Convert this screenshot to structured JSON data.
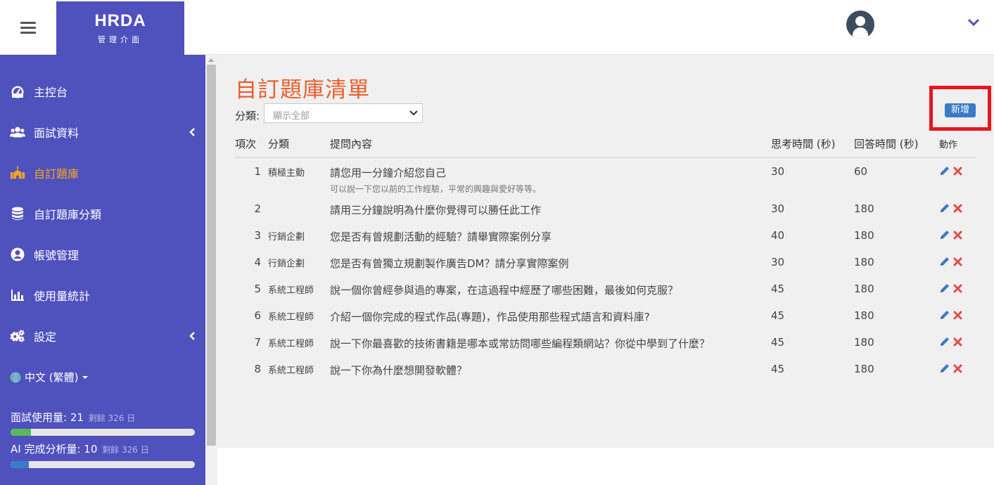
{
  "brand": {
    "name": "HRDA",
    "subtitle": "管理介面"
  },
  "sidebar": {
    "items": [
      {
        "label": "主控台",
        "icon": "dashboard-gauge-icon"
      },
      {
        "label": "面試資料",
        "icon": "users-icon",
        "expandable": true
      },
      {
        "label": "自訂題庫",
        "icon": "custom-bank-icon",
        "active": true
      },
      {
        "label": "自訂題庫分類",
        "icon": "database-icon"
      },
      {
        "label": "帳號管理",
        "icon": "user-circle-icon"
      },
      {
        "label": "使用量統計",
        "icon": "bar-chart-icon"
      },
      {
        "label": "設定",
        "icon": "gears-icon",
        "expandable": true
      }
    ],
    "language": "中文 (繁體)",
    "usage": [
      {
        "label": "面試使用量: 21",
        "remaining": "剩餘 326 日",
        "progress": 0.11,
        "color": "#5cb85c"
      },
      {
        "label": "AI 完成分析量: 10",
        "remaining": "剩餘 326 日",
        "progress": 0.1,
        "color": "#3a7bc8"
      }
    ]
  },
  "main": {
    "title": "自訂題庫清單",
    "filter_label": "分類:",
    "filter_value": "顯示全部",
    "add_label": "新增",
    "columns": [
      "項次",
      "分類",
      "提問內容",
      "思考時間 (秒)",
      "回答時間 (秒)",
      "動作"
    ],
    "rows": [
      {
        "no": "1",
        "category": "積極主動",
        "question": "請您用一分鐘介紹您自己",
        "note": "可以說一下您以前的工作經驗，平常的興趣與愛好等等。",
        "think": "30",
        "answer": "60"
      },
      {
        "no": "2",
        "category": "",
        "question": "請用三分鐘說明為什麼你覺得可以勝任此工作",
        "note": "",
        "think": "30",
        "answer": "180"
      },
      {
        "no": "3",
        "category": "行銷企劃",
        "question": "您是否有曾規劃活動的經驗？請舉實際案例分享",
        "note": "",
        "think": "40",
        "answer": "180"
      },
      {
        "no": "4",
        "category": "行銷企劃",
        "question": "您是否有曾獨立規劃製作廣告DM？請分享實際案例",
        "note": "",
        "think": "30",
        "answer": "180"
      },
      {
        "no": "5",
        "category": "系統工程師",
        "question": "說一個你曾經參與過的專案，在這過程中經歷了哪些困難，最後如何克服？",
        "note": "",
        "think": "45",
        "answer": "180"
      },
      {
        "no": "6",
        "category": "系統工程師",
        "question": "介紹一個你完成的程式作品(專題)，作品使用那些程式語言和資料庫?",
        "note": "",
        "think": "45",
        "answer": "180"
      },
      {
        "no": "7",
        "category": "系統工程師",
        "question": "說一下你最喜歡的技術書籍是哪本或常訪問哪些編程類網站？你從中學到了什麼？",
        "note": "",
        "think": "45",
        "answer": "180"
      },
      {
        "no": "8",
        "category": "系統工程師",
        "question": "說一下你為什麼想開發軟體？",
        "note": "",
        "think": "45",
        "answer": "180"
      }
    ]
  },
  "colors": {
    "sidebar": "#4f51bd",
    "active": "#f5a623",
    "title": "#e6602e",
    "highlight": "#e8161d",
    "button": "#3a7bc8"
  }
}
